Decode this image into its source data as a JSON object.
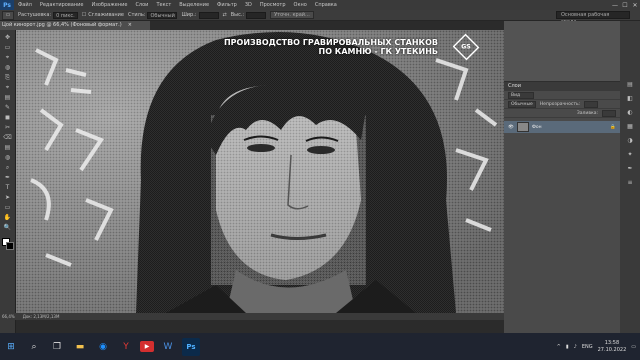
{
  "menubar": {
    "logo": "Ps",
    "items": [
      "Файл",
      "Редактирование",
      "Изображение",
      "Слои",
      "Текст",
      "Выделение",
      "Фильтр",
      "3D",
      "Просмотр",
      "Окно",
      "Справка"
    ],
    "window_buttons": [
      "—",
      "☐",
      "✕"
    ]
  },
  "options": {
    "feather_label": "Растушевка:",
    "feather_value": "0 пикс.",
    "antialias_label": "Сглаживание",
    "style_label": "Стиль:",
    "style_value": "Обычный",
    "width_label": "Шир.:",
    "height_label": "Выс.:",
    "refine_button": "Уточн. край...",
    "workspace": "Основная рабочая среда"
  },
  "document_tab": {
    "title": "Цой кинорот.jpg @ 66,4% (Фоновый формат.)",
    "close": "×"
  },
  "tools": [
    "▭",
    "✥",
    "⌖",
    "✎",
    "◼",
    "⎘",
    "✂",
    "✒",
    "⌫",
    "▤",
    "◍",
    "⌕",
    "T",
    "➤",
    "▭",
    "✋",
    "🔍"
  ],
  "canvas": {
    "watermark_line1": "ПРОИЗВОДСТВО ГРАВИРОВАЛЬНЫХ СТАНКОВ",
    "watermark_line2": "ПО КАМНЮ - ГК УТЕКИНЬ",
    "logo_text": "GS"
  },
  "statusbar": {
    "zoom": "66,4%",
    "doc": "Док: 2,13M/2,13M"
  },
  "layers_panel": {
    "title": "Слои",
    "kind_label": "Вид",
    "blend_mode": "Обычные",
    "opacity_label": "Непрозрачность:",
    "fill_label": "Заливка:",
    "layer_name": "Фон",
    "lock_icon": "lock-icon"
  },
  "taskbar": {
    "apps": [
      "start-icon",
      "search-icon",
      "folder-icon",
      "browser-icon",
      "yandex-icon",
      "media-icon",
      "word-icon",
      "photoshop-icon"
    ],
    "lang": "ENG",
    "time": "13:58",
    "date": "27.10.2022"
  }
}
